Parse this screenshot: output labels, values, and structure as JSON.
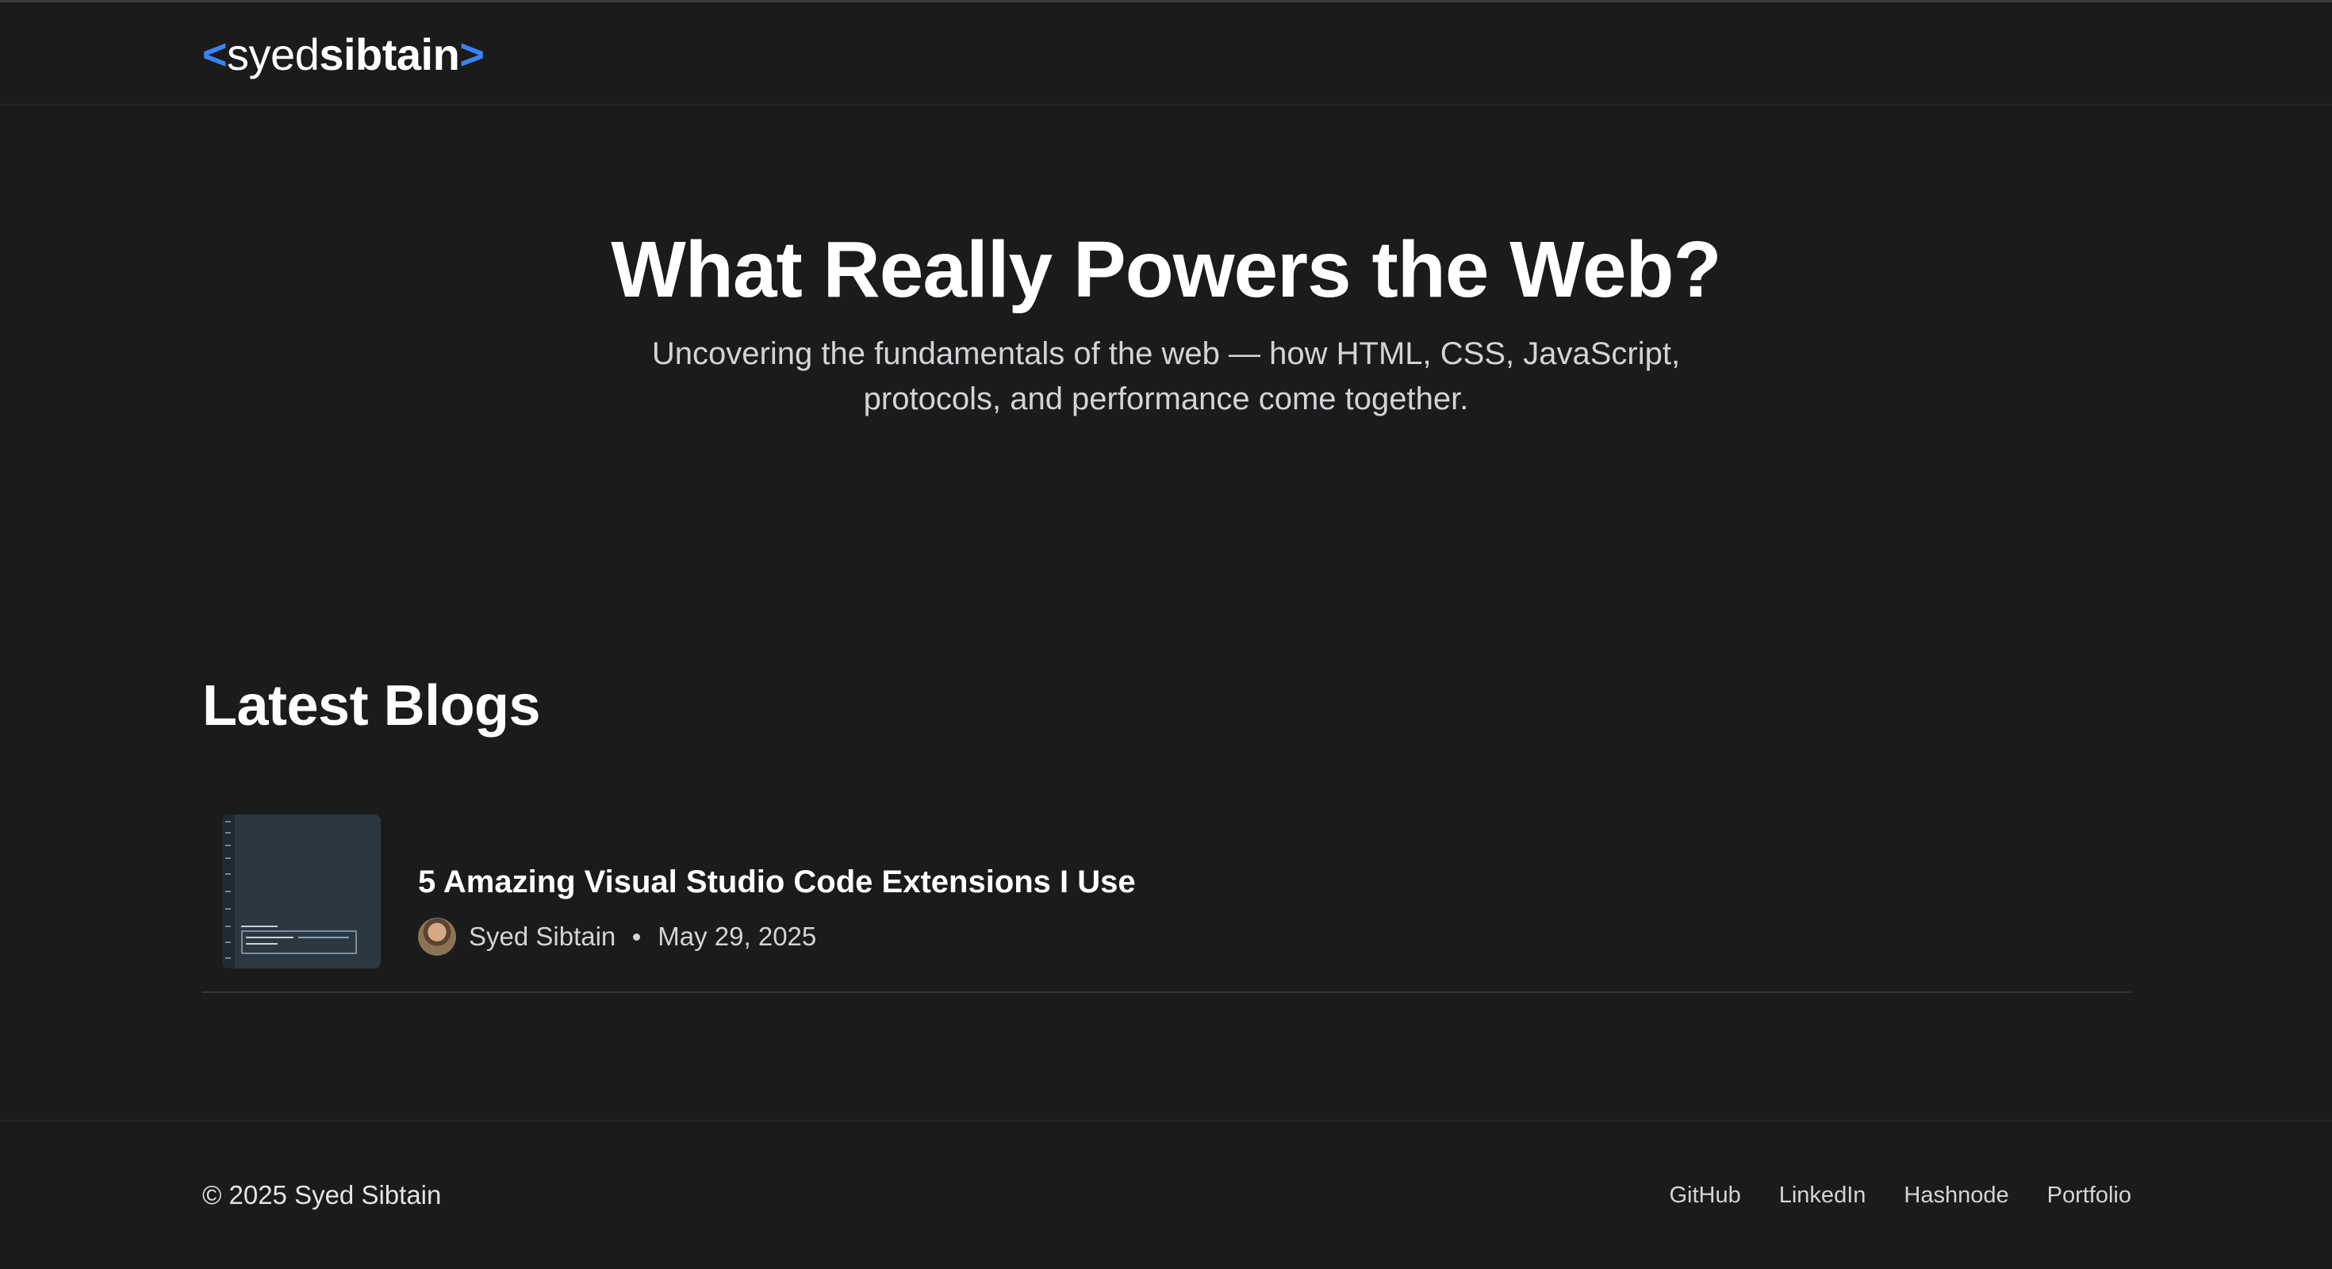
{
  "header": {
    "logo": {
      "open_bracket": "<",
      "first": "syed",
      "second": "sibtain",
      "close_bracket": ">"
    }
  },
  "hero": {
    "title": "What Really Powers the Web?",
    "subtitle": "Uncovering the fundamentals of the web — how HTML, CSS, JavaScript, protocols, and performance come together."
  },
  "blogs_section": {
    "title": "Latest Blogs",
    "posts": [
      {
        "title": "5 Amazing Visual Studio Code Extensions I Use",
        "author": "Syed Sibtain",
        "date": "May 29, 2025"
      }
    ]
  },
  "footer": {
    "copyright": "© 2025 Syed Sibtain",
    "links": [
      "GitHub",
      "LinkedIn",
      "Hashnode",
      "Portfolio"
    ]
  },
  "colors": {
    "background": "#1b1b1c",
    "accent": "#3b82f6",
    "text": "#ffffff",
    "muted": "#d4d4d8"
  }
}
